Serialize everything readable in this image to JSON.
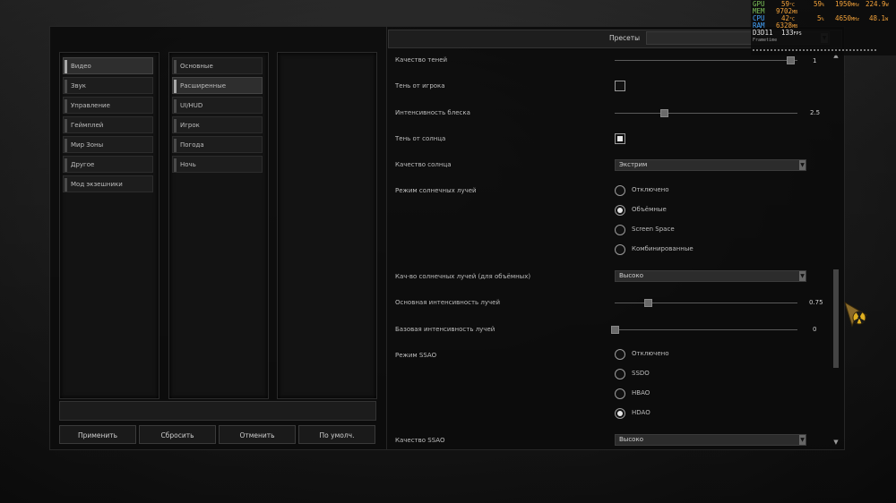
{
  "categories": [
    {
      "label": "Видео",
      "active": true
    },
    {
      "label": "Звук",
      "active": false
    },
    {
      "label": "Управление",
      "active": false
    },
    {
      "label": "Геймплей",
      "active": false
    },
    {
      "label": "Мир Зоны",
      "active": false
    },
    {
      "label": "Другое",
      "active": false
    },
    {
      "label": "Мод экзешники",
      "active": false
    }
  ],
  "subcategories": [
    {
      "label": "Основные",
      "active": false
    },
    {
      "label": "Расширенные",
      "active": true
    },
    {
      "label": "UI/HUD",
      "active": false
    },
    {
      "label": "Игрок",
      "active": false
    },
    {
      "label": "Погода",
      "active": false
    },
    {
      "label": "Ночь",
      "active": false
    }
  ],
  "buttons": {
    "apply": "Применить",
    "reset": "Сбросить",
    "cancel": "Отменить",
    "default": "По умолч."
  },
  "presets": {
    "label": "Пресеты",
    "value": ""
  },
  "settings": {
    "shadow_quality": {
      "label": "Качество теней",
      "value": "1"
    },
    "player_shadow": {
      "label": "Тень от игрока",
      "checked": false
    },
    "gloss_intensity": {
      "label": "Интенсивность блеска",
      "value": "2.5",
      "fraction": 0.27
    },
    "sun_shadow": {
      "label": "Тень от солнца",
      "checked": true
    },
    "sun_quality": {
      "label": "Качество солнца",
      "value": "Экстрим"
    },
    "sunrays_mode": {
      "label": "Режим солнечных лучей",
      "options": [
        "Отключено",
        "Объёмные",
        "Screen Space",
        "Комбинированные"
      ],
      "selected": 1
    },
    "sunrays_quality": {
      "label": "Кач-во солнечных лучей (для объёмных)",
      "value": "Высоко"
    },
    "rays_main_intensity": {
      "label": "Основная интенсивность лучей",
      "value": "0.75",
      "fraction": 0.18
    },
    "rays_base_intensity": {
      "label": "Базовая интенсивность лучей",
      "value": "0",
      "fraction": 0.0
    },
    "ssao_mode": {
      "label": "Режим SSAO",
      "options": [
        "Отключено",
        "SSDO",
        "HBAO",
        "HDAO"
      ],
      "selected": 3
    },
    "ssao_quality": {
      "label": "Качество SSAO",
      "value": "Высоко"
    }
  },
  "overlay": {
    "gpu": {
      "label": "GPU",
      "v1": "59",
      "v1u": "°C",
      "v2": "59",
      "v2u": "%",
      "v3": "1950",
      "v3u": "MHz",
      "v4": "224.9",
      "v4u": "W"
    },
    "mem": {
      "label": "MEM",
      "v1": "9702",
      "v1u": "MB"
    },
    "cpu": {
      "label": "CPU",
      "v1": "42",
      "v1u": "°C",
      "v2": "5",
      "v2u": "%",
      "v3": "4650",
      "v3u": "MHz",
      "v4": "48.1",
      "v4u": "W"
    },
    "ram": {
      "label": "RAM",
      "v1": "6328",
      "v1u": "MB"
    },
    "d3d": {
      "label": "D3D11",
      "v1": "133",
      "v1u": "FPS"
    },
    "frametime": "Frametime",
    "colors": {
      "gpu": "#7cc35a",
      "mem": "#7cc35a",
      "cpu": "#43a4ff",
      "ram": "#43a4ff",
      "d3d": "#e6e6e6",
      "value": "#f3a23a"
    }
  }
}
